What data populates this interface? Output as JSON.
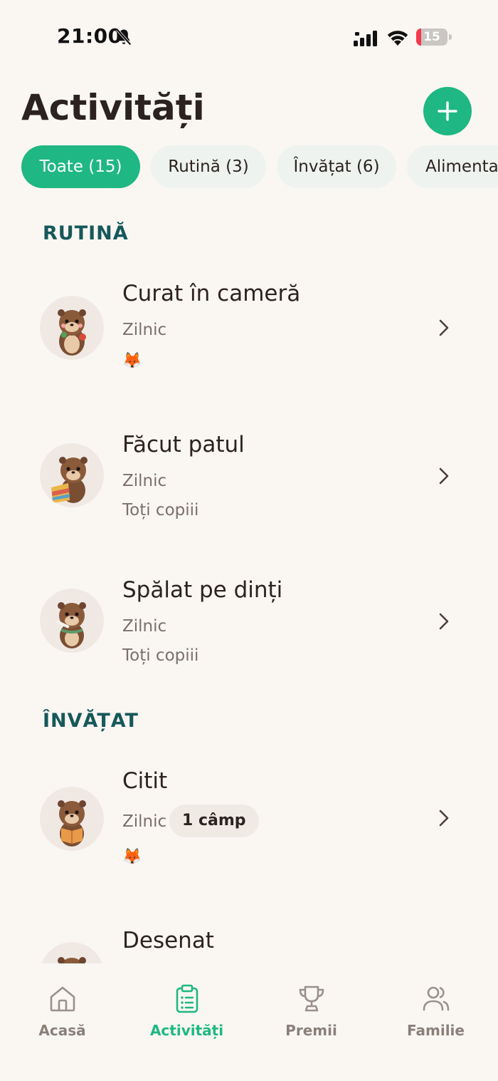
{
  "status_bar": {
    "time": "21:00",
    "battery_level": "15",
    "battery_fraction": 0.15,
    "icons": [
      "bell-slash-icon",
      "cellular-signal-icon",
      "wifi-icon",
      "battery-icon"
    ]
  },
  "header": {
    "title": "Activități",
    "add_button_icon": "plus-icon"
  },
  "filters": [
    {
      "label": "Toate (15)",
      "active": true
    },
    {
      "label": "Rutină (3)",
      "active": false
    },
    {
      "label": "Învățat (6)",
      "active": false
    },
    {
      "label": "Alimenta",
      "active": false
    }
  ],
  "sections": {
    "rutina": {
      "title": "RUTINĂ",
      "items": [
        {
          "title": "Curat în cameră",
          "frequency": "Zilnic",
          "emoji": "🦊"
        },
        {
          "title": "Făcut patul",
          "frequency": "Zilnic",
          "assignees": "Toți copiii"
        },
        {
          "title": "Spălat pe dinți",
          "frequency": "Zilnic",
          "assignees": "Toți copiii"
        }
      ]
    },
    "invatat": {
      "title": "ÎNVĂȚAT",
      "items": [
        {
          "title": "Citit",
          "frequency": "Zilnic",
          "badge": "1 câmp",
          "emoji": "🦊"
        },
        {
          "title": "Desenat"
        }
      ]
    }
  },
  "tabbar": [
    {
      "label": "Acasă",
      "icon": "home-icon",
      "active": false
    },
    {
      "label": "Activități",
      "icon": "clipboard-icon",
      "active": true
    },
    {
      "label": "Premii",
      "icon": "trophy-icon",
      "active": false
    },
    {
      "label": "Familie",
      "icon": "users-icon",
      "active": false
    }
  ],
  "colors": {
    "accent": "#1fb783",
    "section_heading": "#16585a",
    "background": "#faf7f3"
  }
}
